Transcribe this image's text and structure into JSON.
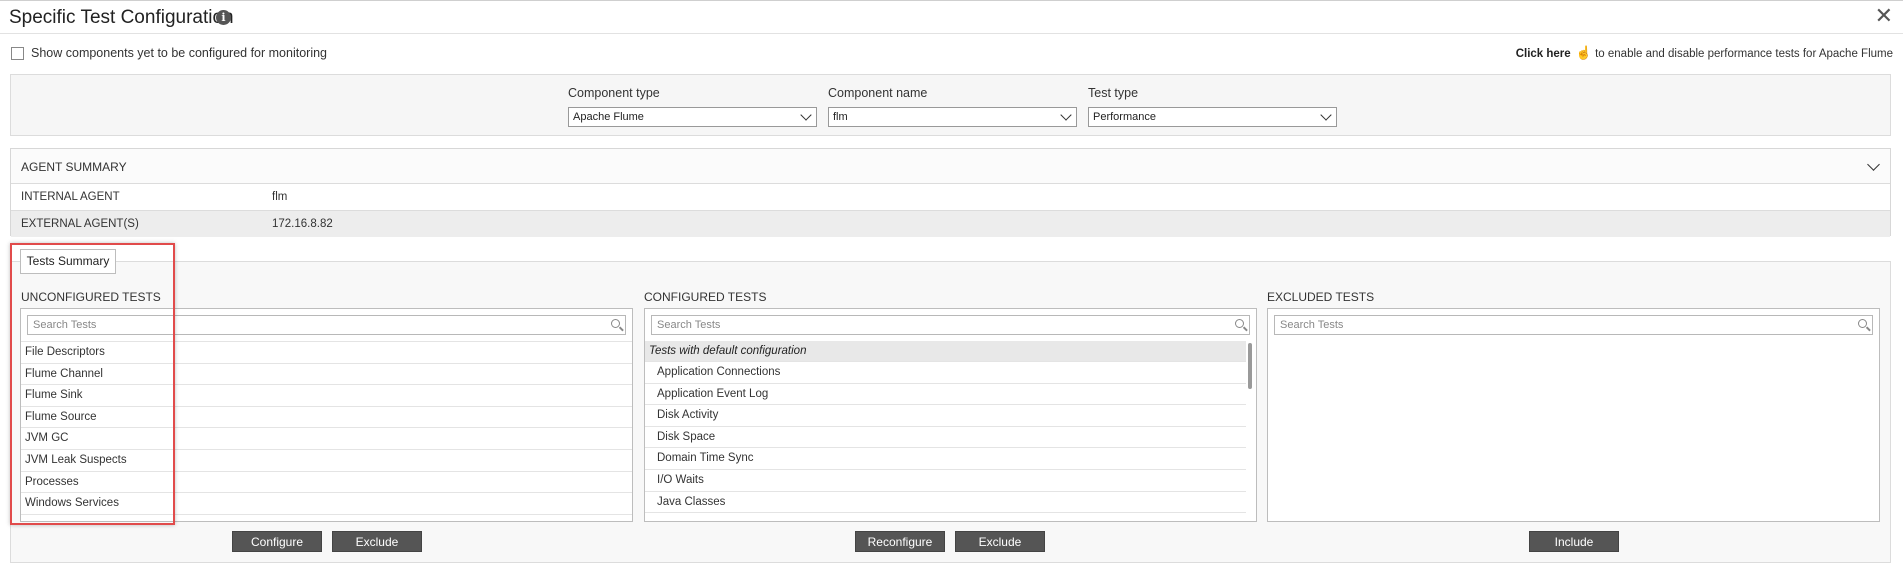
{
  "title": "Specific Test Configuration",
  "checkbox_label": "Show components yet to be configured for monitoring",
  "click_here": {
    "link": "Click here",
    "rest": "to enable and disable performance tests for Apache Flume"
  },
  "filters": {
    "component_type": {
      "label": "Component type",
      "value": "Apache Flume"
    },
    "component_name": {
      "label": "Component name",
      "value": "flm"
    },
    "test_type": {
      "label": "Test type",
      "value": "Performance"
    }
  },
  "agent_summary": {
    "title": "AGENT SUMMARY",
    "rows": [
      {
        "key": "INTERNAL AGENT",
        "value": "flm"
      },
      {
        "key": "EXTERNAL AGENT(S)",
        "value": "172.16.8.82"
      }
    ]
  },
  "tests_summary_tab": "Tests Summary",
  "unconfigured": {
    "title": "UNCONFIGURED TESTS",
    "placeholder": "Search Tests",
    "items": [
      "File Descriptors",
      "Flume Channel",
      "Flume Sink",
      "Flume Source",
      "JVM GC",
      "JVM Leak Suspects",
      "Processes",
      "Windows Services"
    ],
    "buttons": {
      "configure": "Configure",
      "exclude": "Exclude"
    }
  },
  "configured": {
    "title": "CONFIGURED TESTS",
    "placeholder": "Search Tests",
    "group": "Tests with default configuration",
    "items": [
      "Application Connections",
      "Application Event Log",
      "Disk Activity",
      "Disk Space",
      "Domain Time Sync",
      "I/O Waits",
      "Java Classes"
    ],
    "buttons": {
      "reconfigure": "Reconfigure",
      "exclude": "Exclude"
    }
  },
  "excluded": {
    "title": "EXCLUDED TESTS",
    "placeholder": "Search Tests",
    "buttons": {
      "include": "Include"
    }
  },
  "colors": {
    "highlight": "#e14b4b",
    "button_bg": "#555555"
  }
}
